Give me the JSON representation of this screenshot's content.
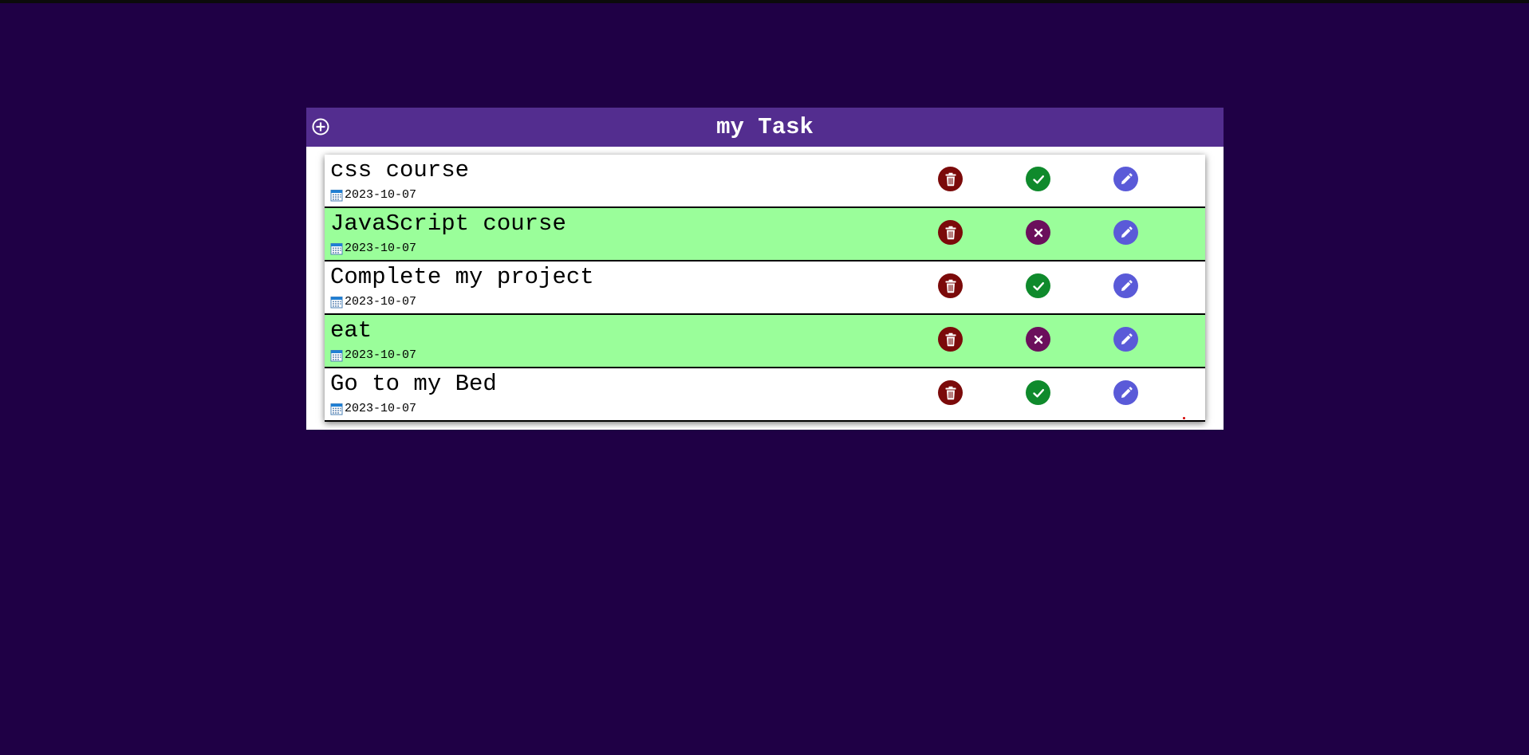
{
  "header": {
    "title": "my Task",
    "add_icon": "plus-circle-icon"
  },
  "tasks": [
    {
      "title": "css course",
      "date": "2023-10-07",
      "completed": false,
      "toggle_icon": "check-icon"
    },
    {
      "title": "JavaScript course",
      "date": "2023-10-07",
      "completed": true,
      "toggle_icon": "x-icon"
    },
    {
      "title": "Complete my project",
      "date": "2023-10-07",
      "completed": false,
      "toggle_icon": "check-icon"
    },
    {
      "title": "eat",
      "date": "2023-10-07",
      "completed": true,
      "toggle_icon": "x-icon"
    },
    {
      "title": "Go to my Bed",
      "date": "2023-10-07",
      "completed": false,
      "toggle_icon": "check-icon"
    }
  ],
  "icons": {
    "delete": "trash-icon",
    "edit": "pencil-icon",
    "date": "calendar-icon"
  },
  "colors": {
    "page_background": "#1f0045",
    "header_background": "#532d8f",
    "completed_row": "#9afe9a",
    "delete": "#7b0a0a",
    "check": "#0f8a2c",
    "cross": "#6b0f5c",
    "edit": "#5a5ad8"
  }
}
